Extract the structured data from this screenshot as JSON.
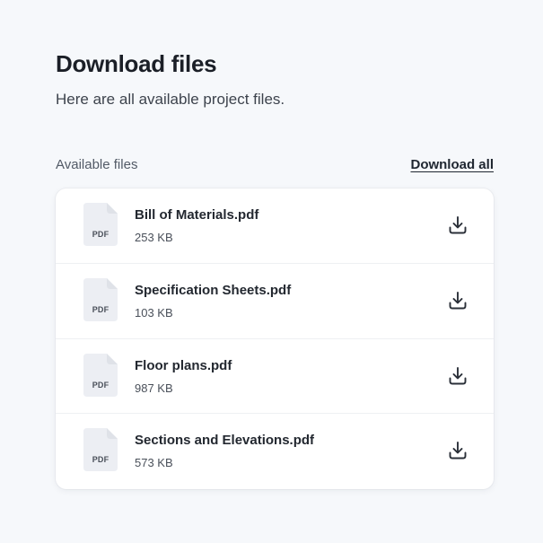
{
  "header": {
    "title": "Download files",
    "subtitle": "Here are all available project files."
  },
  "files_section": {
    "label": "Available files",
    "download_all_label": "Download all"
  },
  "files": [
    {
      "name": "Bill of Materials.pdf",
      "size": "253 KB",
      "type_label": "PDF",
      "icon": "pdf-file-icon"
    },
    {
      "name": "Specification Sheets.pdf",
      "size": "103 KB",
      "type_label": "PDF",
      "icon": "pdf-file-icon"
    },
    {
      "name": "Floor plans.pdf",
      "size": "987 KB",
      "type_label": "PDF",
      "icon": "pdf-file-icon"
    },
    {
      "name": "Sections and Elevations.pdf",
      "size": "573 KB",
      "type_label": "PDF",
      "icon": "pdf-file-icon"
    }
  ],
  "colors": {
    "background": "#f6f8fb",
    "card": "#ffffff",
    "file_icon_fill": "#eceef3",
    "text_primary": "#1b1f27"
  }
}
